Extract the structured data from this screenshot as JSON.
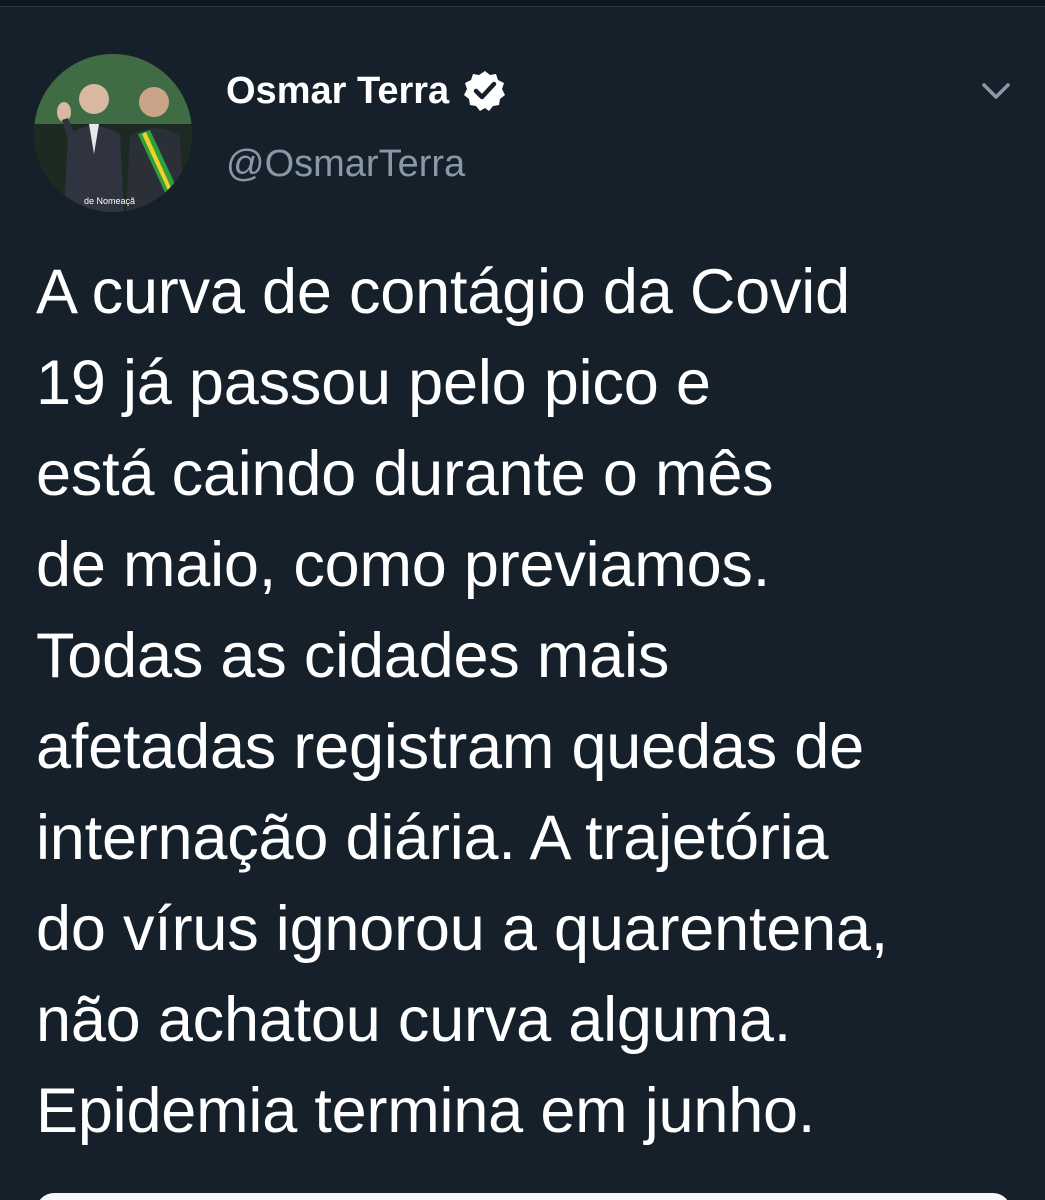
{
  "author": {
    "name": "Osmar Terra",
    "handle": "@OsmarTerra",
    "verified": true,
    "avatar_caption": "de Nomeaçã"
  },
  "icons": {
    "verified": "verified-badge-icon",
    "more": "chevron-down-icon"
  },
  "tweet": {
    "lines": [
      "A curva de contágio da Covid",
      "19 já passou pelo pico e",
      "está caindo durante o mês",
      "de maio, como previamos.",
      "Todas as cidades mais",
      "afetadas registram quedas de",
      "internação diária. A trajetória",
      "do vírus ignorou a quarentena,",
      "não achatou curva alguma.",
      "Epidemia termina em junho."
    ]
  },
  "colors": {
    "background": "#15202b",
    "text": "#ffffff",
    "secondary_text": "#8899a6"
  }
}
